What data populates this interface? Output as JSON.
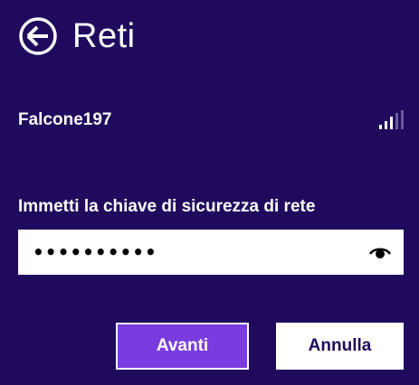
{
  "header": {
    "back_icon": "arrow-left-circle-icon",
    "title": "Reti"
  },
  "network": {
    "name": "Falcone197",
    "signal_icon": "wifi-signal-bars-icon",
    "signal_level": 0.5
  },
  "security_key": {
    "label": "Immetti la chiave di sicurezza di rete",
    "masked_value": "••••••••••",
    "reveal_icon": "eye-reveal-password-icon"
  },
  "buttons": {
    "next_label": "Avanti",
    "cancel_label": "Annulla"
  },
  "colors": {
    "background": "#1f0a5e",
    "accent": "#7a3ce0",
    "text": "#ffffff"
  }
}
